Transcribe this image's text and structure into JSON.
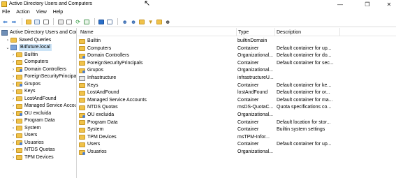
{
  "window": {
    "title": "Active Directory Users and Computers",
    "minimize": "—",
    "maximize": "❐",
    "close": "✕"
  },
  "menu": [
    "File",
    "Action",
    "View",
    "Help"
  ],
  "toolbar_icons": [
    "back-icon",
    "forward-icon",
    "up-folder-icon",
    "show-hide-tree-icon",
    "properties-list-icon",
    "delete-icon",
    "properties-icon",
    "refresh-icon",
    "export-list-icon",
    "help-icon",
    "details-view-icon",
    "new-user-icon",
    "new-group-icon",
    "new-ou-icon",
    "filter-icon",
    "find-icon",
    "add-to-group-icon"
  ],
  "tree": {
    "root": "Active Directory Users and Comp",
    "saved_queries": "Saved Queries",
    "domain": "B4future.local",
    "children": [
      "Builtin",
      "Computers",
      "Domain Controllers",
      "ForeignSecurityPrincipals",
      "Grupos",
      "Keys",
      "LostAndFound",
      "Managed Service Accoun",
      "OU excluida",
      "Program Data",
      "System",
      "Users",
      "Usuarios",
      "NTDS Quotas",
      "TPM Devices"
    ]
  },
  "list": {
    "columns": [
      "Name",
      "Type",
      "Description"
    ],
    "rows": [
      {
        "name": "Builtin",
        "type": "builtinDomain",
        "description": ""
      },
      {
        "name": "Computers",
        "type": "Container",
        "description": "Default container for up..."
      },
      {
        "name": "Domain Controllers",
        "type": "Organizational...",
        "description": "Default container for do..."
      },
      {
        "name": "ForeignSecurityPrincipals",
        "type": "Container",
        "description": "Default container for sec..."
      },
      {
        "name": "Grupos",
        "type": "Organizational...",
        "description": ""
      },
      {
        "name": "Infrastructure",
        "type": "infrastructureU...",
        "description": ""
      },
      {
        "name": "Keys",
        "type": "Container",
        "description": "Default container for ke..."
      },
      {
        "name": "LostAndFound",
        "type": "lostAndFound",
        "description": "Default container for or..."
      },
      {
        "name": "Managed Service Accounts",
        "type": "Container",
        "description": "Default container for ma..."
      },
      {
        "name": "NTDS Quotas",
        "type": "msDS-QuotaC...",
        "description": "Quota specifications co..."
      },
      {
        "name": "OU excluida",
        "type": "Organizational...",
        "description": ""
      },
      {
        "name": "Program Data",
        "type": "Container",
        "description": "Default location for stor..."
      },
      {
        "name": "System",
        "type": "Container",
        "description": "Builtin system settings"
      },
      {
        "name": "TPM Devices",
        "type": "msTPM-Infor...",
        "description": ""
      },
      {
        "name": "Users",
        "type": "Container",
        "description": "Default container for up..."
      },
      {
        "name": "Usuarios",
        "type": "Organizational...",
        "description": ""
      }
    ]
  }
}
